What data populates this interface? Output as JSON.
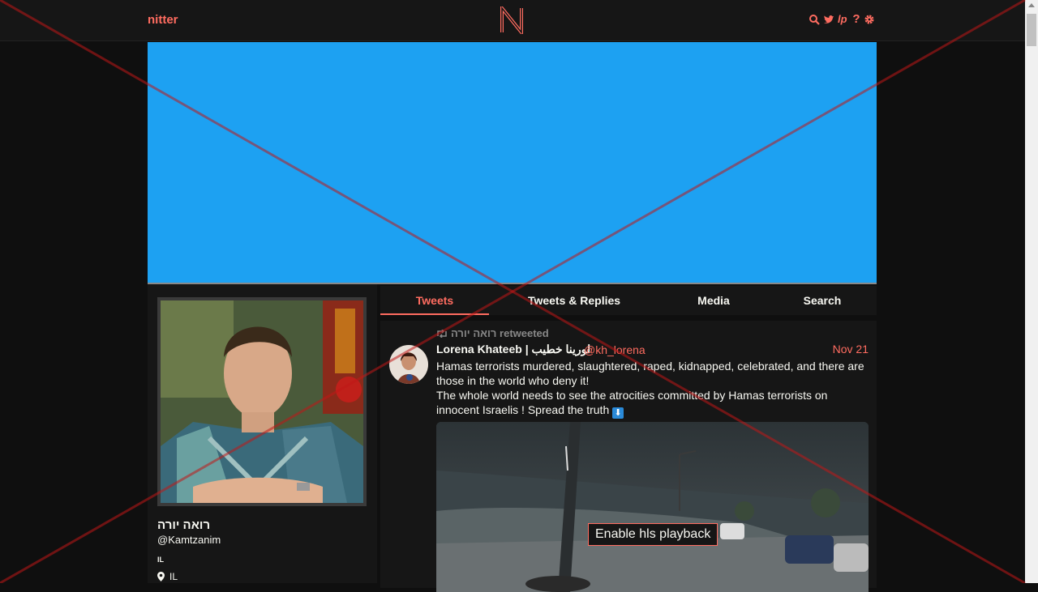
{
  "nav": {
    "brand": "nitter",
    "logo_letter": "N",
    "icons": [
      "search-icon",
      "twitter-bird-icon",
      "lp-icon",
      "help-icon",
      "gear-icon"
    ],
    "lp_label": "lp",
    "help_label": "?"
  },
  "profile": {
    "fullname": "רואה יורה",
    "username": "@Kamtzanim",
    "bio": "IL",
    "location": "IL"
  },
  "tabs": [
    {
      "label": "Tweets",
      "active": true
    },
    {
      "label": "Tweets & Replies",
      "active": false
    },
    {
      "label": "Media",
      "active": false
    },
    {
      "label": "Search",
      "active": false
    }
  ],
  "tweet": {
    "retweet_header": "רואה יורה retweeted",
    "fullname": "Lorena Khateeb | لورينا خطيب",
    "username": "@kh_lorena",
    "date": "Nov 21",
    "body_line1": "Hamas terrorists murdered, slaughtered, raped, kidnapped, celebrated, and there are those in the world who deny it!",
    "body_line2": "The whole world needs to see the atrocities committed by Hamas terrorists on innocent Israelis ! Spread the truth",
    "arrow_emoji": "⬇",
    "hls_button": "Enable hls playback"
  },
  "colors": {
    "accent": "#ff6c60",
    "banner": "#1da1f2",
    "background": "#0f0f0f",
    "panel": "#161616"
  }
}
